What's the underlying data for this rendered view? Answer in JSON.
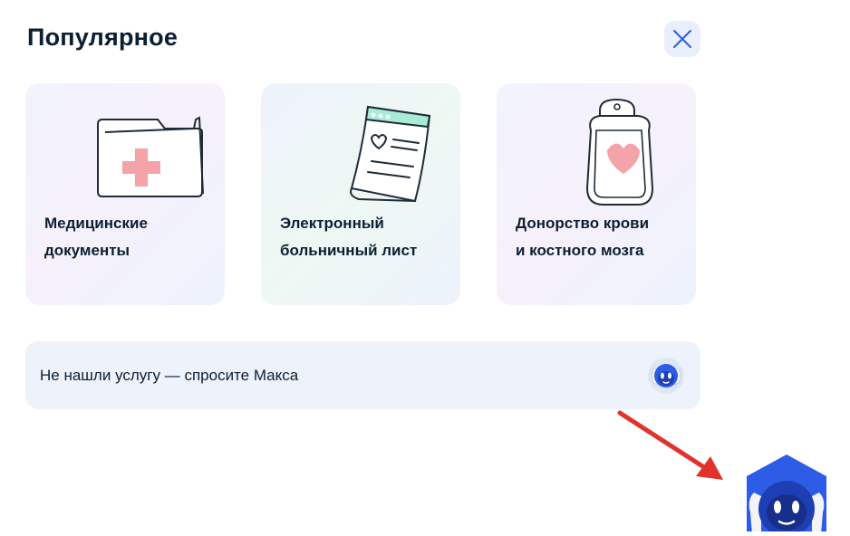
{
  "header": {
    "title": "Популярное"
  },
  "colors": {
    "accent": "#2d5ce6",
    "arrow": "#e2322c",
    "card_bg": "#f1f3fd",
    "bar_bg": "#edf2fb"
  },
  "cards": [
    {
      "label_line1": "Медицинские",
      "label_line2": "документы",
      "icon": "medical-folder-icon"
    },
    {
      "label_line1": "Электронный",
      "label_line2": "больничный лист",
      "icon": "sick-leave-document-icon"
    },
    {
      "label_line1": "Донорство крови",
      "label_line2": "и костного мозга",
      "icon": "blood-bag-icon"
    }
  ],
  "ask": {
    "text": "Не нашли услугу — спросите Макса",
    "avatar": "max-robot-avatar-icon"
  }
}
